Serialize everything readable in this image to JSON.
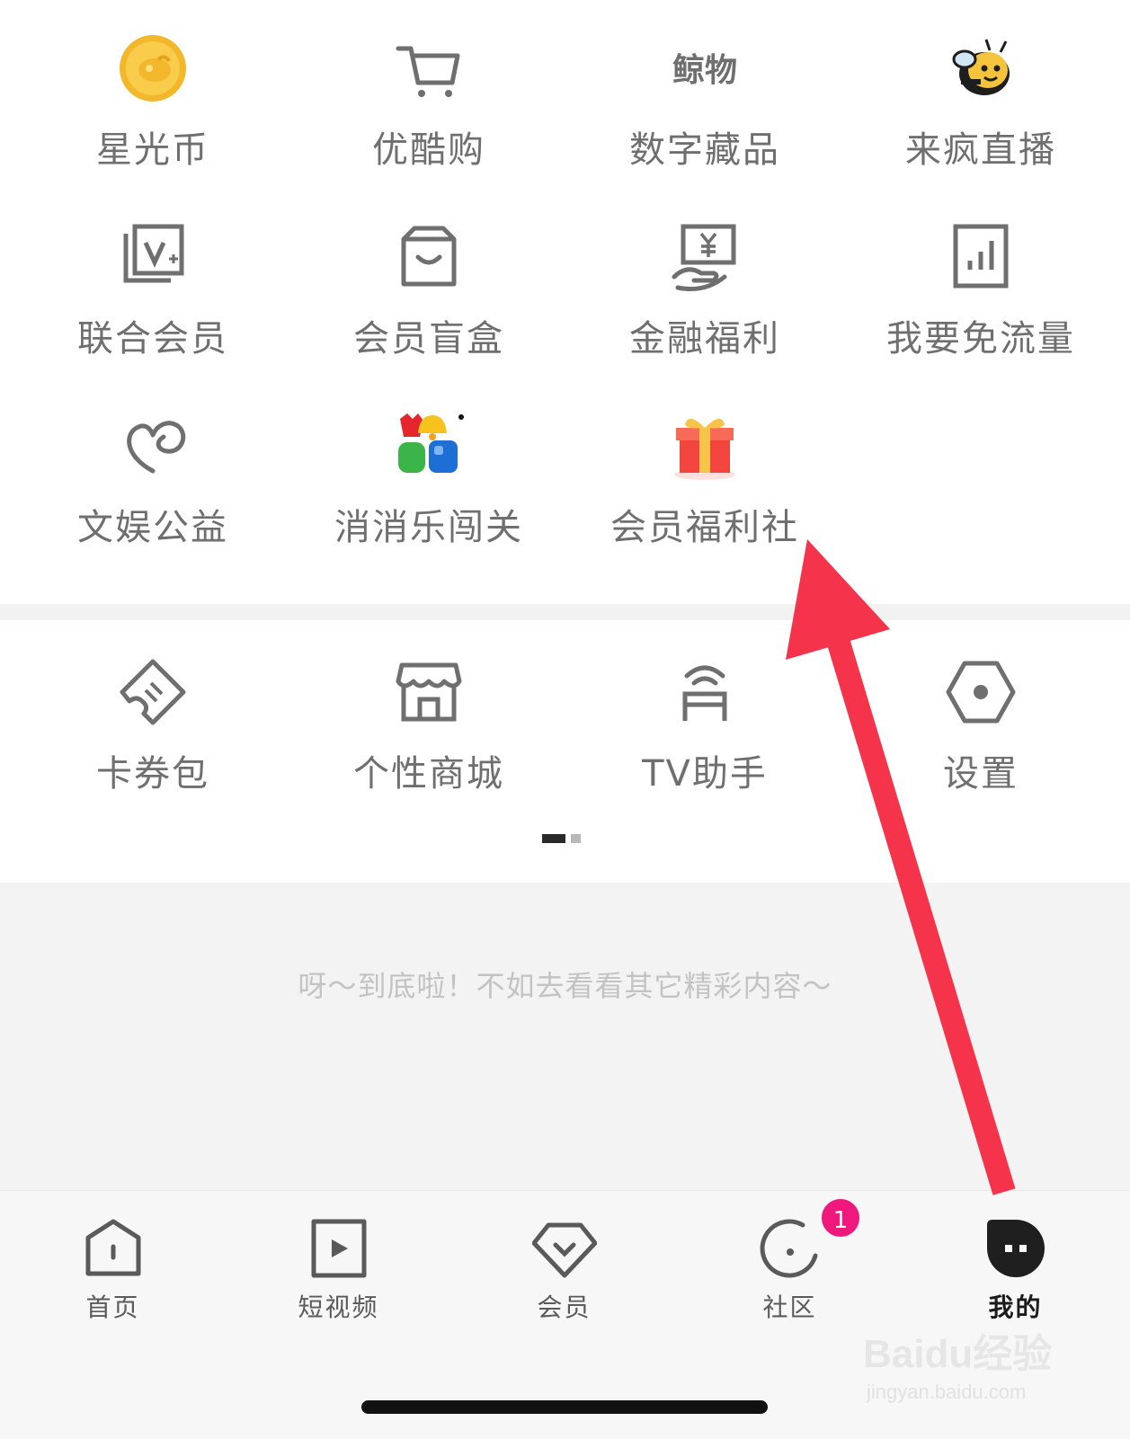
{
  "services": {
    "items": [
      {
        "label": "星光币",
        "icon": "star-coin-icon"
      },
      {
        "label": "优酷购",
        "icon": "shopping-cart-icon"
      },
      {
        "label": "数字藏品",
        "icon": "digital-collectible-icon"
      },
      {
        "label": "来疯直播",
        "icon": "bee-live-icon"
      },
      {
        "label": "联合会员",
        "icon": "joint-vip-icon"
      },
      {
        "label": "会员盲盒",
        "icon": "blind-box-icon"
      },
      {
        "label": "金融福利",
        "icon": "finance-icon"
      },
      {
        "label": "我要免流量",
        "icon": "free-data-icon"
      },
      {
        "label": "文娱公益",
        "icon": "charity-heart-icon"
      },
      {
        "label": "消消乐闯关",
        "icon": "match-game-icon"
      },
      {
        "label": "会员福利社",
        "icon": "gift-box-icon"
      }
    ],
    "digital_logo_text": "鲸物"
  },
  "tools": {
    "items": [
      {
        "label": "卡券包",
        "icon": "ticket-icon"
      },
      {
        "label": "个性商城",
        "icon": "store-icon"
      },
      {
        "label": "TV助手",
        "icon": "tv-cast-icon"
      },
      {
        "label": "设置",
        "icon": "settings-hex-icon"
      }
    ],
    "page_count": 2,
    "current_page": 1
  },
  "footer": {
    "end_text": "呀～到底啦！不如去看看其它精彩内容～"
  },
  "tabbar": {
    "tabs": [
      {
        "label": "首页",
        "icon": "home-icon"
      },
      {
        "label": "短视频",
        "icon": "short-video-icon"
      },
      {
        "label": "会员",
        "icon": "vip-diamond-icon"
      },
      {
        "label": "社区",
        "icon": "community-icon",
        "badge": "1"
      },
      {
        "label": "我的",
        "icon": "profile-icon",
        "active": true
      }
    ]
  },
  "watermark": {
    "main": "Baidu经验",
    "sub": "jingyan.baidu.com"
  },
  "colors": {
    "label_gray": "#6f6f6f",
    "badge_pink": "#f0187c",
    "annotation_arrow": "#f5334a"
  }
}
